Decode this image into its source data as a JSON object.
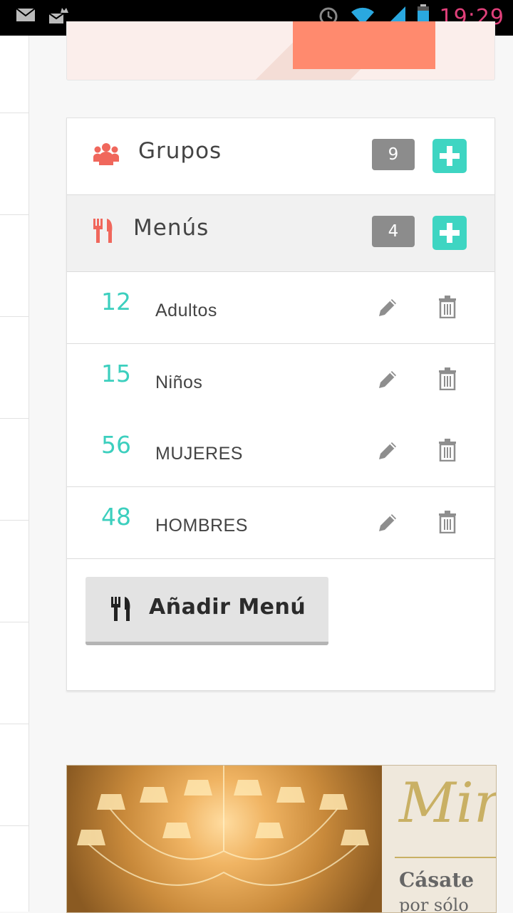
{
  "status_bar": {
    "time": "19:29",
    "icons": [
      "mail-icon",
      "crown-mail-icon",
      "alarm-icon",
      "wifi-icon",
      "signal-icon",
      "battery-icon"
    ]
  },
  "grupos": {
    "title": "Grupos",
    "count": "9",
    "icon": "users-icon"
  },
  "menus": {
    "title": "Menús",
    "count": "4",
    "icon": "utensils-icon",
    "items": [
      {
        "number": "12",
        "name": "Adultos"
      },
      {
        "number": "15",
        "name": "Niños"
      },
      {
        "number": "56",
        "name": "MUJERES"
      },
      {
        "number": "48",
        "name": "HOMBRES"
      }
    ],
    "add_button_label": "Añadir Menú"
  },
  "ad": {
    "script_text": "Mir",
    "line1": "Cásate",
    "line2": "por sólo"
  },
  "colors": {
    "accent": "#3ed5c2",
    "icon_red": "#f0675c",
    "badge_grey": "#8c8c8c",
    "number_teal": "#3ccfbe"
  }
}
